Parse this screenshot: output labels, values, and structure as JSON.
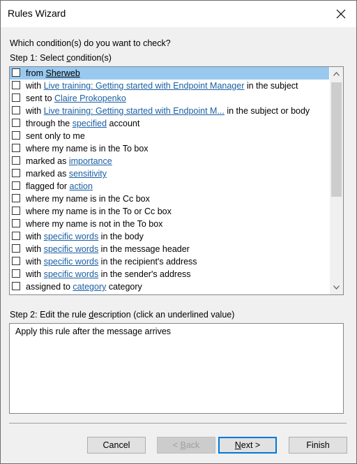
{
  "window": {
    "title": "Rules Wizard"
  },
  "question": "Which condition(s) do you want to check?",
  "step1": {
    "pre": "Step 1: Select ",
    "accel": "c",
    "post": "ondition(s)"
  },
  "conditions": [
    {
      "parts": [
        {
          "t": "from "
        },
        {
          "t": "Sherweb",
          "link": true
        }
      ],
      "selected": true
    },
    {
      "parts": [
        {
          "t": "with "
        },
        {
          "t": "Live training: Getting started with Endpoint Manager",
          "link": true
        },
        {
          "t": " in the subject"
        }
      ]
    },
    {
      "parts": [
        {
          "t": "sent to "
        },
        {
          "t": "Claire Prokopenko",
          "link": true
        }
      ]
    },
    {
      "parts": [
        {
          "t": "with "
        },
        {
          "t": "Live training: Getting started with Endpoint M...",
          "link": true
        },
        {
          "t": " in the subject or body"
        }
      ]
    },
    {
      "parts": [
        {
          "t": "through the "
        },
        {
          "t": "specified",
          "link": true
        },
        {
          "t": " account"
        }
      ]
    },
    {
      "parts": [
        {
          "t": "sent only to me"
        }
      ]
    },
    {
      "parts": [
        {
          "t": "where my name is in the To box"
        }
      ]
    },
    {
      "parts": [
        {
          "t": "marked as "
        },
        {
          "t": "importance",
          "link": true
        }
      ]
    },
    {
      "parts": [
        {
          "t": "marked as "
        },
        {
          "t": "sensitivity",
          "link": true
        }
      ]
    },
    {
      "parts": [
        {
          "t": "flagged for "
        },
        {
          "t": "action",
          "link": true
        }
      ]
    },
    {
      "parts": [
        {
          "t": "where my name is in the Cc box"
        }
      ]
    },
    {
      "parts": [
        {
          "t": "where my name is in the To or Cc box"
        }
      ]
    },
    {
      "parts": [
        {
          "t": "where my name is not in the To box"
        }
      ]
    },
    {
      "parts": [
        {
          "t": "with "
        },
        {
          "t": "specific words",
          "link": true
        },
        {
          "t": " in the body"
        }
      ]
    },
    {
      "parts": [
        {
          "t": "with "
        },
        {
          "t": "specific words",
          "link": true
        },
        {
          "t": " in the message header"
        }
      ]
    },
    {
      "parts": [
        {
          "t": "with "
        },
        {
          "t": "specific words",
          "link": true
        },
        {
          "t": " in the recipient's address"
        }
      ]
    },
    {
      "parts": [
        {
          "t": "with "
        },
        {
          "t": "specific words",
          "link": true
        },
        {
          "t": " in the sender's address"
        }
      ]
    },
    {
      "parts": [
        {
          "t": "assigned to "
        },
        {
          "t": "category",
          "link": true
        },
        {
          "t": " category"
        }
      ]
    }
  ],
  "step2": {
    "pre": "Step 2: Edit the rule ",
    "accel": "d",
    "post": "escription (click an underlined value)"
  },
  "description": "Apply this rule after the message arrives",
  "buttons": {
    "cancel": "Cancel",
    "back": {
      "pre": "< ",
      "accel": "B",
      "post": "ack"
    },
    "next": {
      "accel": "N",
      "post": "ext >"
    },
    "finish": "Finish"
  },
  "colors": {
    "selection": "#99c9ef",
    "link": "#1a5fa3",
    "primary_border": "#0078d7"
  },
  "icons": {
    "close": "close-icon",
    "scroll_up": "chevron-up-icon",
    "scroll_down": "chevron-down-icon"
  }
}
